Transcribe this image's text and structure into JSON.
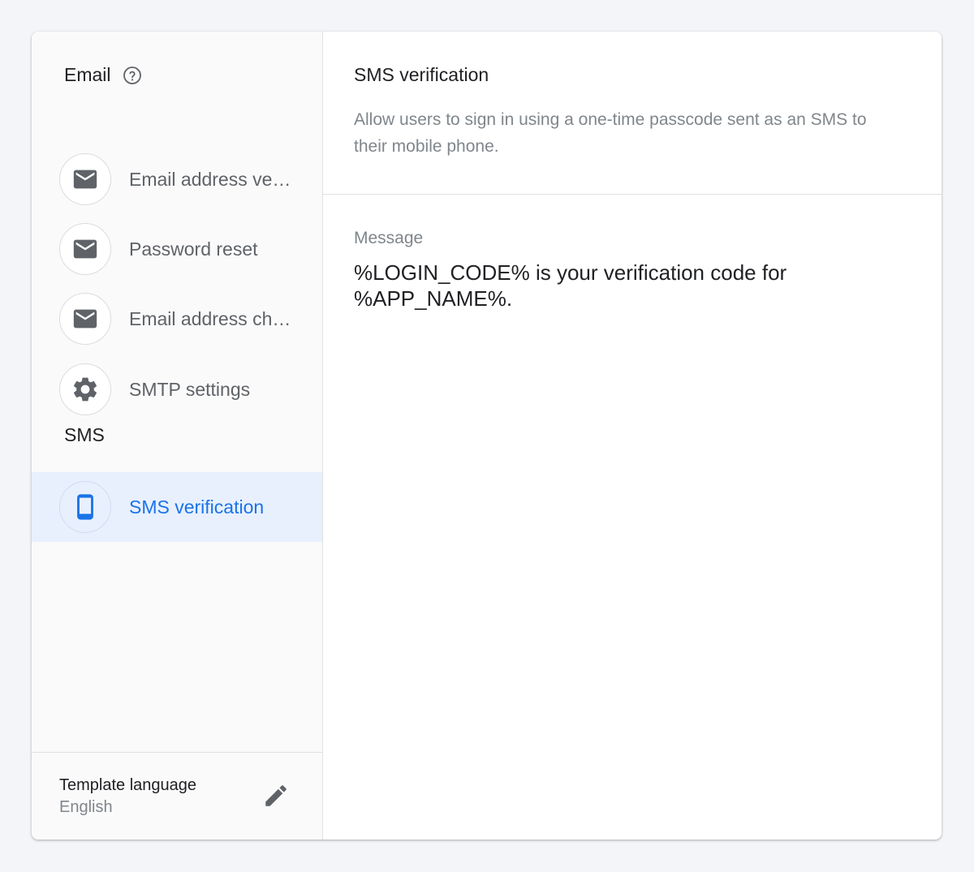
{
  "sidebar": {
    "email_section": {
      "title": "Email",
      "items": [
        {
          "label": "Email address verification",
          "icon": "mail-icon"
        },
        {
          "label": "Password reset",
          "icon": "mail-icon"
        },
        {
          "label": "Email address change",
          "icon": "mail-icon"
        },
        {
          "label": "SMTP settings",
          "icon": "gear-icon"
        }
      ]
    },
    "sms_section": {
      "title": "SMS",
      "items": [
        {
          "label": "SMS verification",
          "icon": "phone-icon",
          "active": true
        }
      ]
    },
    "footer": {
      "label": "Template language",
      "value": "English"
    }
  },
  "main": {
    "title": "SMS verification",
    "description": "Allow users to sign in using a one-time passcode sent as an SMS to their mobile phone.",
    "message_label": "Message",
    "message_text": "%LOGIN_CODE% is your verification code for %APP_NAME%."
  },
  "colors": {
    "accent": "#1a73e8",
    "active_bg": "#e8f0fe",
    "icon_gray": "#5f6368",
    "background": "#f4f5f8"
  }
}
